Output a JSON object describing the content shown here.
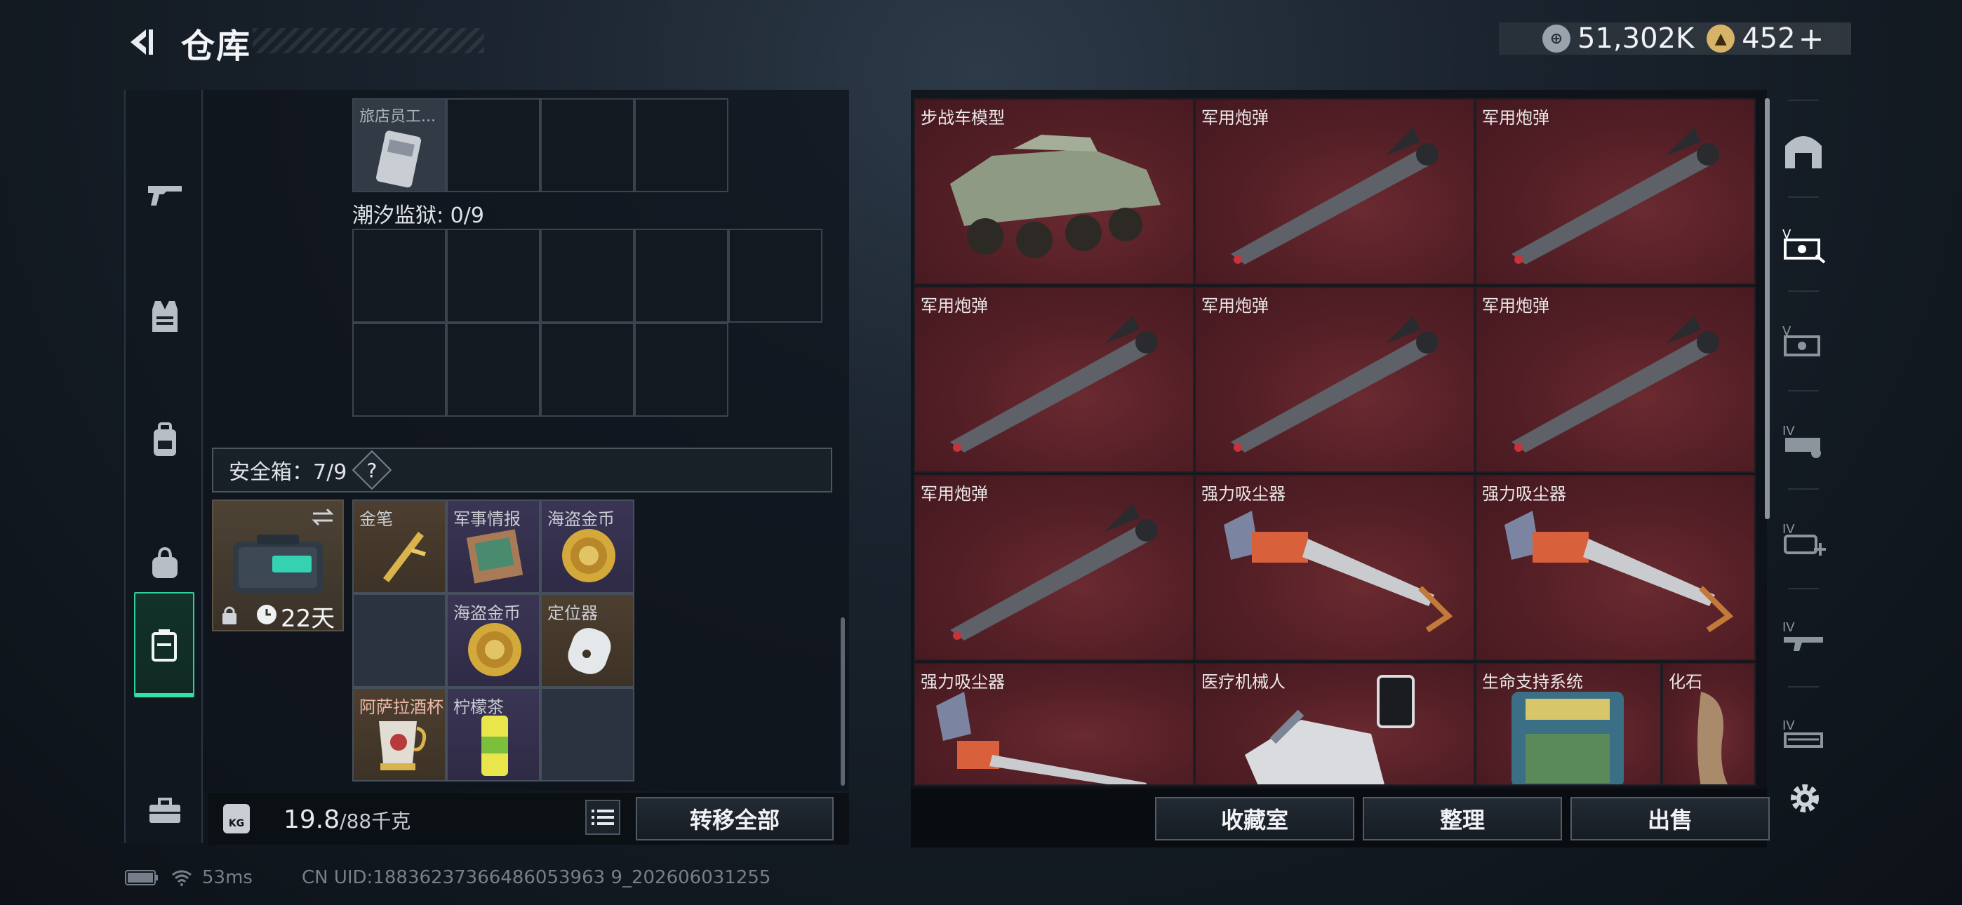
{
  "header": {
    "title": "仓库",
    "back_icon": "back-arrow-icon"
  },
  "currency": [
    {
      "icon": "coin-icon",
      "value": "51,302K"
    },
    {
      "icon": "triangle-coin-icon",
      "value": "452"
    }
  ],
  "currency_plus": "+",
  "left_nav": [
    {
      "name": "weapon",
      "icon": "gun-icon"
    },
    {
      "name": "armor",
      "icon": "vest-icon"
    },
    {
      "name": "backpack",
      "icon": "backpack-icon"
    },
    {
      "name": "bag",
      "icon": "bag-icon"
    },
    {
      "name": "safebox",
      "icon": "safebox-icon",
      "active": true
    },
    {
      "name": "toolbox",
      "icon": "toolbox-icon"
    }
  ],
  "stash": {
    "top_item": "旅店员工...",
    "tide_prison_label": "潮汐监狱: 0/9",
    "safe_label": "安全箱：7/9",
    "help": "?",
    "safebox_days": "22天",
    "safe_items": [
      {
        "name": "金笔",
        "bg": "gold"
      },
      {
        "name": "军事情报",
        "bg": "purple"
      },
      {
        "name": "海盗金币",
        "bg": "purple"
      },
      {
        "name": "",
        "bg": "empty"
      },
      {
        "name": "海盗金币",
        "bg": "purple"
      },
      {
        "name": "定位器",
        "bg": "gold"
      },
      {
        "name": "阿萨拉酒杯",
        "bg": "gold"
      },
      {
        "name": "柠檬茶",
        "bg": "purple"
      },
      {
        "name": "",
        "bg": "empty"
      }
    ]
  },
  "weight": {
    "current": "19.8",
    "max": "/88千克",
    "kg": "KG"
  },
  "buttons": {
    "transfer_all": "转移全部",
    "collection": "收藏室",
    "organize": "整理",
    "sell": "出售"
  },
  "warehouse_items": [
    {
      "name": "步战车模型",
      "type": "vehicle"
    },
    {
      "name": "军用炮弹",
      "type": "missile"
    },
    {
      "name": "军用炮弹",
      "type": "missile"
    },
    {
      "name": "军用炮弹",
      "type": "missile"
    },
    {
      "name": "军用炮弹",
      "type": "missile"
    },
    {
      "name": "军用炮弹",
      "type": "missile"
    },
    {
      "name": "军用炮弹",
      "type": "missile"
    },
    {
      "name": "强力吸尘器",
      "type": "vacuum"
    },
    {
      "name": "强力吸尘器",
      "type": "vacuum"
    },
    {
      "name": "强力吸尘器",
      "type": "vacuum"
    },
    {
      "name": "医疗机械人",
      "type": "robot"
    },
    {
      "name": "生命支持系统",
      "type": "lifesupport"
    },
    {
      "name": "化石",
      "type": "fossil"
    }
  ],
  "right_nav": [
    {
      "icon": "arch-icon"
    },
    {
      "icon": "tag-sort-icon"
    },
    {
      "icon": "tag-sort-alt-icon"
    },
    {
      "icon": "iv-ammo-icon"
    },
    {
      "icon": "iv-medkit-icon"
    },
    {
      "icon": "iv-weapon-icon"
    },
    {
      "icon": "iv-gear-icon"
    }
  ],
  "status": {
    "ping": "53ms",
    "uid": "CN UID:18836237366486053963 9_202606031255"
  },
  "colors": {
    "accent": "#35e0a8",
    "red_cell": "#521e25",
    "gold_cell": "#4d3f30",
    "purple_cell": "#3a3554"
  }
}
